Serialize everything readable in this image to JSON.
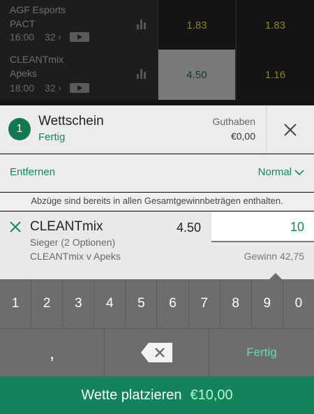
{
  "matches": [
    {
      "team1": "AGF Esports",
      "team2": "PACT",
      "time": "16:00",
      "markets_count": "32",
      "odds": [
        "1.83",
        "1.83"
      ],
      "selected_index": -1
    },
    {
      "team1": "CLEANTmix",
      "team2": "Apeks",
      "time": "18:00",
      "markets_count": "32",
      "odds": [
        "4.50",
        "1.16"
      ],
      "selected_index": 0
    }
  ],
  "icons": {
    "stats": "bar-chart-icon",
    "live_stream": "play-icon",
    "more": "chevron-right-icon",
    "close": "close-icon",
    "remove": "close-icon",
    "dropdown": "chevron-down-icon",
    "backspace": "backspace-icon"
  },
  "betslip": {
    "count": "1",
    "title": "Wettschein",
    "status": "Fertig",
    "balance_label": "Guthaben",
    "balance_value": "€0,00",
    "remove_label": "Entfernen",
    "mode_label": "Normal",
    "info_note": "Abzüge sind bereits in allen Gesamtgewinnbeträgen enthalten.",
    "selection": {
      "name": "CLEANTmix",
      "market": "Sieger (2 Optionen)",
      "event": "CLEANTmix v Apeks",
      "odds": "4.50",
      "stake": "10",
      "return_text": "Gewinn 42,75"
    }
  },
  "keypad": {
    "digits": [
      "1",
      "2",
      "3",
      "4",
      "5",
      "6",
      "7",
      "8",
      "9",
      "0"
    ],
    "comma": ",",
    "done": "Fertig"
  },
  "place_bet": {
    "label": "Wette platzieren",
    "amount": "€10,00"
  },
  "colors": {
    "accent": "#13885a",
    "place_bet_bg": "#12835a",
    "keypad_bg": "#6d6d6d",
    "odds_text": "#8a8420"
  }
}
